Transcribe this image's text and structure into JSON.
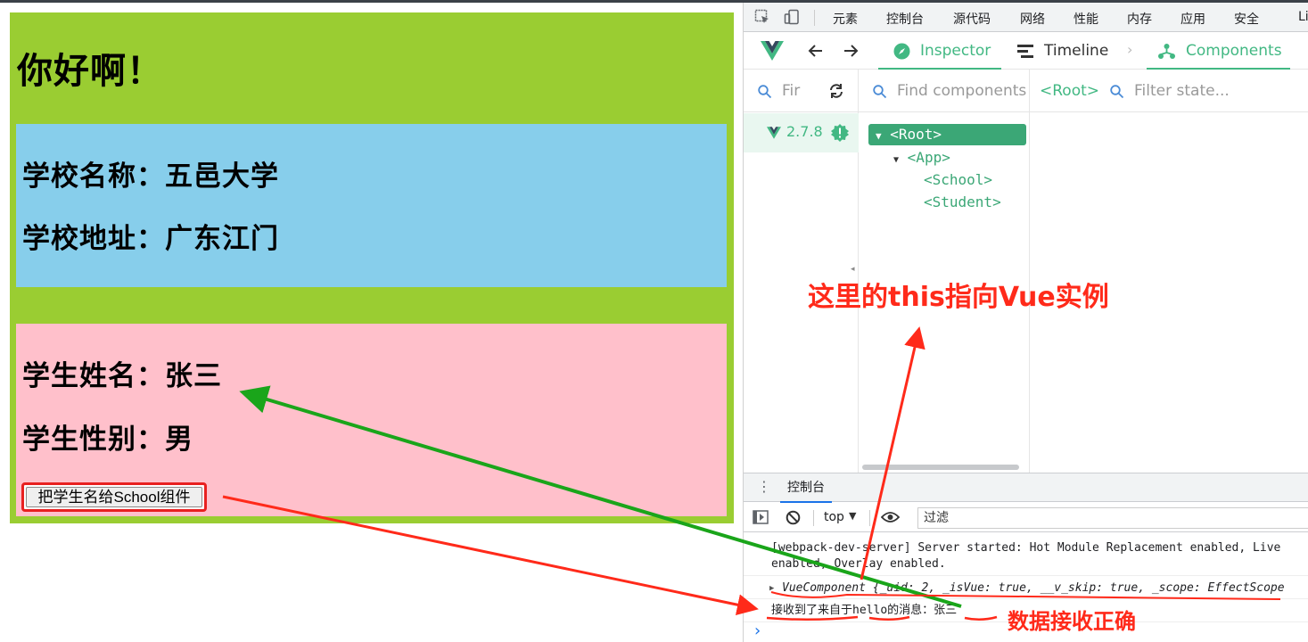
{
  "app": {
    "title": "你好啊！",
    "school": {
      "name": "学校名称：五邑大学",
      "address": "学校地址：广东江门"
    },
    "student": {
      "name": "学生姓名：张三",
      "gender": "学生性别：男",
      "button": "把学生名给School组件"
    }
  },
  "devtools": {
    "tabs": [
      "元素",
      "控制台",
      "源代码",
      "网络",
      "性能",
      "内存",
      "应用",
      "安全",
      "Li"
    ],
    "vue": {
      "tabs": [
        "Inspector",
        "Timeline",
        "Components"
      ],
      "search_apps": "Fir",
      "find_placeholder": "Find components",
      "selected": "<Root>",
      "filter_state": "Filter state...",
      "version": "2.7.8",
      "tree": [
        "<Root>",
        "<App>",
        "<School>",
        "<Student>"
      ]
    },
    "console": {
      "tab": "控制台",
      "context": "top",
      "filter": "过滤",
      "logs": {
        "server_line1": "[webpack-dev-server] Server started: Hot Module Replacement enabled, Live",
        "server_line2": "enabled, Overlay enabled.",
        "vc_name": "VueComponent",
        "vc_body_a": "{_uid: ",
        "vc_uid": "2",
        "vc_body_b": ", _isVue: ",
        "vc_true1": "true",
        "vc_body_c": ", __v_skip: ",
        "vc_true2": "true",
        "vc_body_d": ", _scope: EffectScope",
        "msg_a": "接收到了来自于",
        "msg_hello": "hello",
        "msg_b": "的消息：",
        "msg_name": "张三"
      },
      "prompt": "›"
    }
  },
  "annotations": {
    "this_note": "这里的this指向Vue实例",
    "data_note": "数据接收正确"
  },
  "colors": {
    "app_bg": "#9acd32",
    "school_bg": "#87ceeb",
    "student_bg": "#ffc0cb",
    "vue_green": "#42b883",
    "anno_red": "#ff2a1a",
    "arrow_green": "#1aa51a"
  }
}
